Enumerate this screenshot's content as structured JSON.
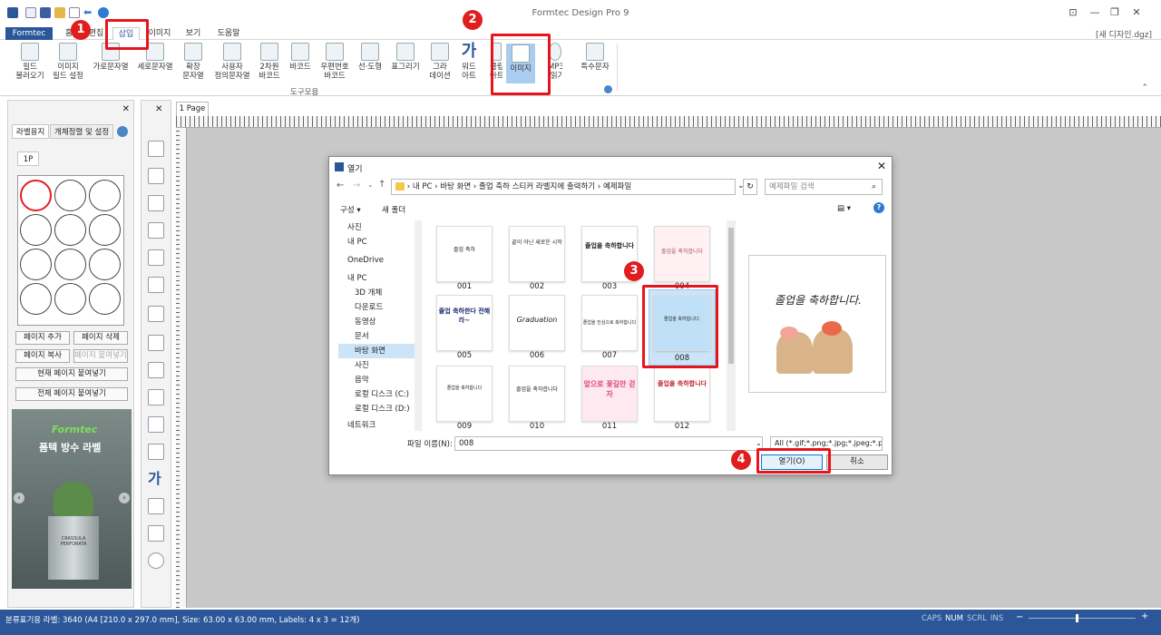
{
  "app": {
    "title": "Formtec Design Pro 9",
    "doc_name": "[새 디자인.dgz]"
  },
  "tabs": [
    "Formtec",
    "홈",
    "편집",
    "삽입",
    "이미지",
    "보기",
    "도움말"
  ],
  "ribbon": {
    "items": [
      "필드\n불러오기",
      "이미지\n필드 설정",
      "가로문자열",
      "세로문자열",
      "확장\n문자열",
      "사용자\n정의문자열",
      "2차원\n바코드",
      "바코드",
      "우편번호\n바코드",
      "선·도형",
      "표그리기",
      "그라\n데이션",
      "워드\n아트",
      "클립\n아트",
      "이미지",
      "MP3\n·읽기",
      "특수문자"
    ],
    "group_label": "도구모음"
  },
  "left_panel": {
    "tabs": [
      "라벨용지",
      "개체정렬 및 설정"
    ],
    "page_tab": "1P",
    "buttons": [
      "페이지 추가",
      "페이지 삭제",
      "페이지 복사",
      "페이지 붙여넣기",
      "현재 페이지 붙여넣기",
      "전체 페이지 붙여넣기"
    ],
    "ad": {
      "brand": "Formtec",
      "headline": "폼텍 방수 라벨",
      "pot_text": "CRASSULA PERFORATA"
    }
  },
  "page_tab": "1 Page",
  "dialog": {
    "title": "열기",
    "address": [
      "내 PC",
      "바탕 화면",
      "졸업 축하 스티커 라벨지에 출력하기",
      "예제파일"
    ],
    "search_placeholder": "예제파일 검색",
    "toolbar": {
      "organize": "구성",
      "new_folder": "새 폴더"
    },
    "tree": [
      "사진",
      "내 PC",
      "OneDrive",
      "내 PC",
      "3D 개체",
      "다운로드",
      "동영상",
      "문서",
      "바탕 화면",
      "사진",
      "음악",
      "로컬 디스크 (C:)",
      "로컬 디스크 (D:)",
      "네트워크"
    ],
    "files": [
      {
        "name": "001",
        "text": "졸업 축하"
      },
      {
        "name": "002",
        "text": "끝이 아닌 새로운 시작"
      },
      {
        "name": "003",
        "text": "졸업을 축하합니다"
      },
      {
        "name": "004",
        "text": "졸업을 축하합니다"
      },
      {
        "name": "005",
        "text": "졸업 축하한다 전해라~"
      },
      {
        "name": "006",
        "text": "Graduation"
      },
      {
        "name": "007",
        "text": "졸업을 진심으로 축하합니다"
      },
      {
        "name": "008",
        "text": "졸업을 축하합니다."
      },
      {
        "name": "009",
        "text": "졸업을 축하합니다"
      },
      {
        "name": "010",
        "text": "졸업을 축하합니다"
      },
      {
        "name": "011",
        "text": "앞으로 꽃길만 걷자"
      },
      {
        "name": "012",
        "text": "졸업을 축하합니다"
      }
    ],
    "preview_text": "졸업을 축하합니다.",
    "filename_label": "파일 이름(N):",
    "filename_value": "008",
    "filetype": "All (*.gif;*.png;*.jpg;*.jpeg;*.pn",
    "open_button": "열기(O)",
    "cancel_button": "취소"
  },
  "status": {
    "text": "분류표기용 라벨: 3640 (A4 [210.0 x 297.0 mm], Size: 63.00 x 63.00 mm, Labels: 4 x 3 = 12개)",
    "keys": [
      "CAPS",
      "NUM",
      "SCRL",
      "INS"
    ]
  },
  "annotations": [
    "1",
    "2",
    "3",
    "4"
  ]
}
